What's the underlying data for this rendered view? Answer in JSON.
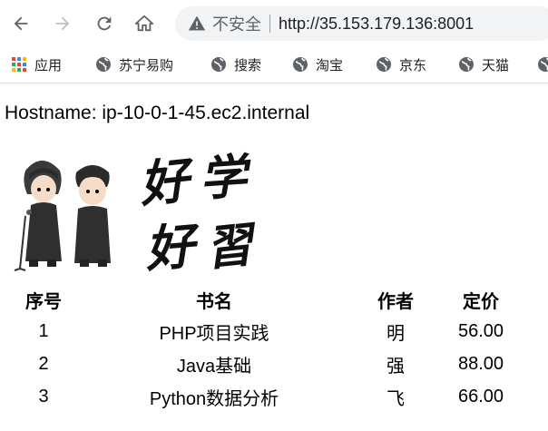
{
  "browser": {
    "security_label": "不安全",
    "url": "http://35.153.179.136:8001",
    "nav_icons": [
      "back-arrow-icon",
      "forward-arrow-icon",
      "reload-icon",
      "home-icon"
    ]
  },
  "bookmarks": [
    {
      "label": "应用",
      "icon": "apps-grid-icon"
    },
    {
      "label": "苏宁易购",
      "icon": "globe-icon"
    },
    {
      "label": "搜索",
      "icon": "globe-icon"
    },
    {
      "label": "淘宝",
      "icon": "globe-icon"
    },
    {
      "label": "京东",
      "icon": "globe-icon"
    },
    {
      "label": "天猫",
      "icon": "globe-icon"
    }
  ],
  "page": {
    "hostname_line": "Hostname: ip-10-0-1-45.ec2.internal",
    "banner_text": "好学好習",
    "table": {
      "headers": [
        "序号",
        "书名",
        "作者",
        "定价"
      ],
      "rows": [
        [
          "1",
          "PHP项目实践",
          "明",
          "56.00"
        ],
        [
          "2",
          "Java基础",
          "强",
          "88.00"
        ],
        [
          "3",
          "Python数据分析",
          "飞",
          "66.00"
        ]
      ]
    }
  }
}
